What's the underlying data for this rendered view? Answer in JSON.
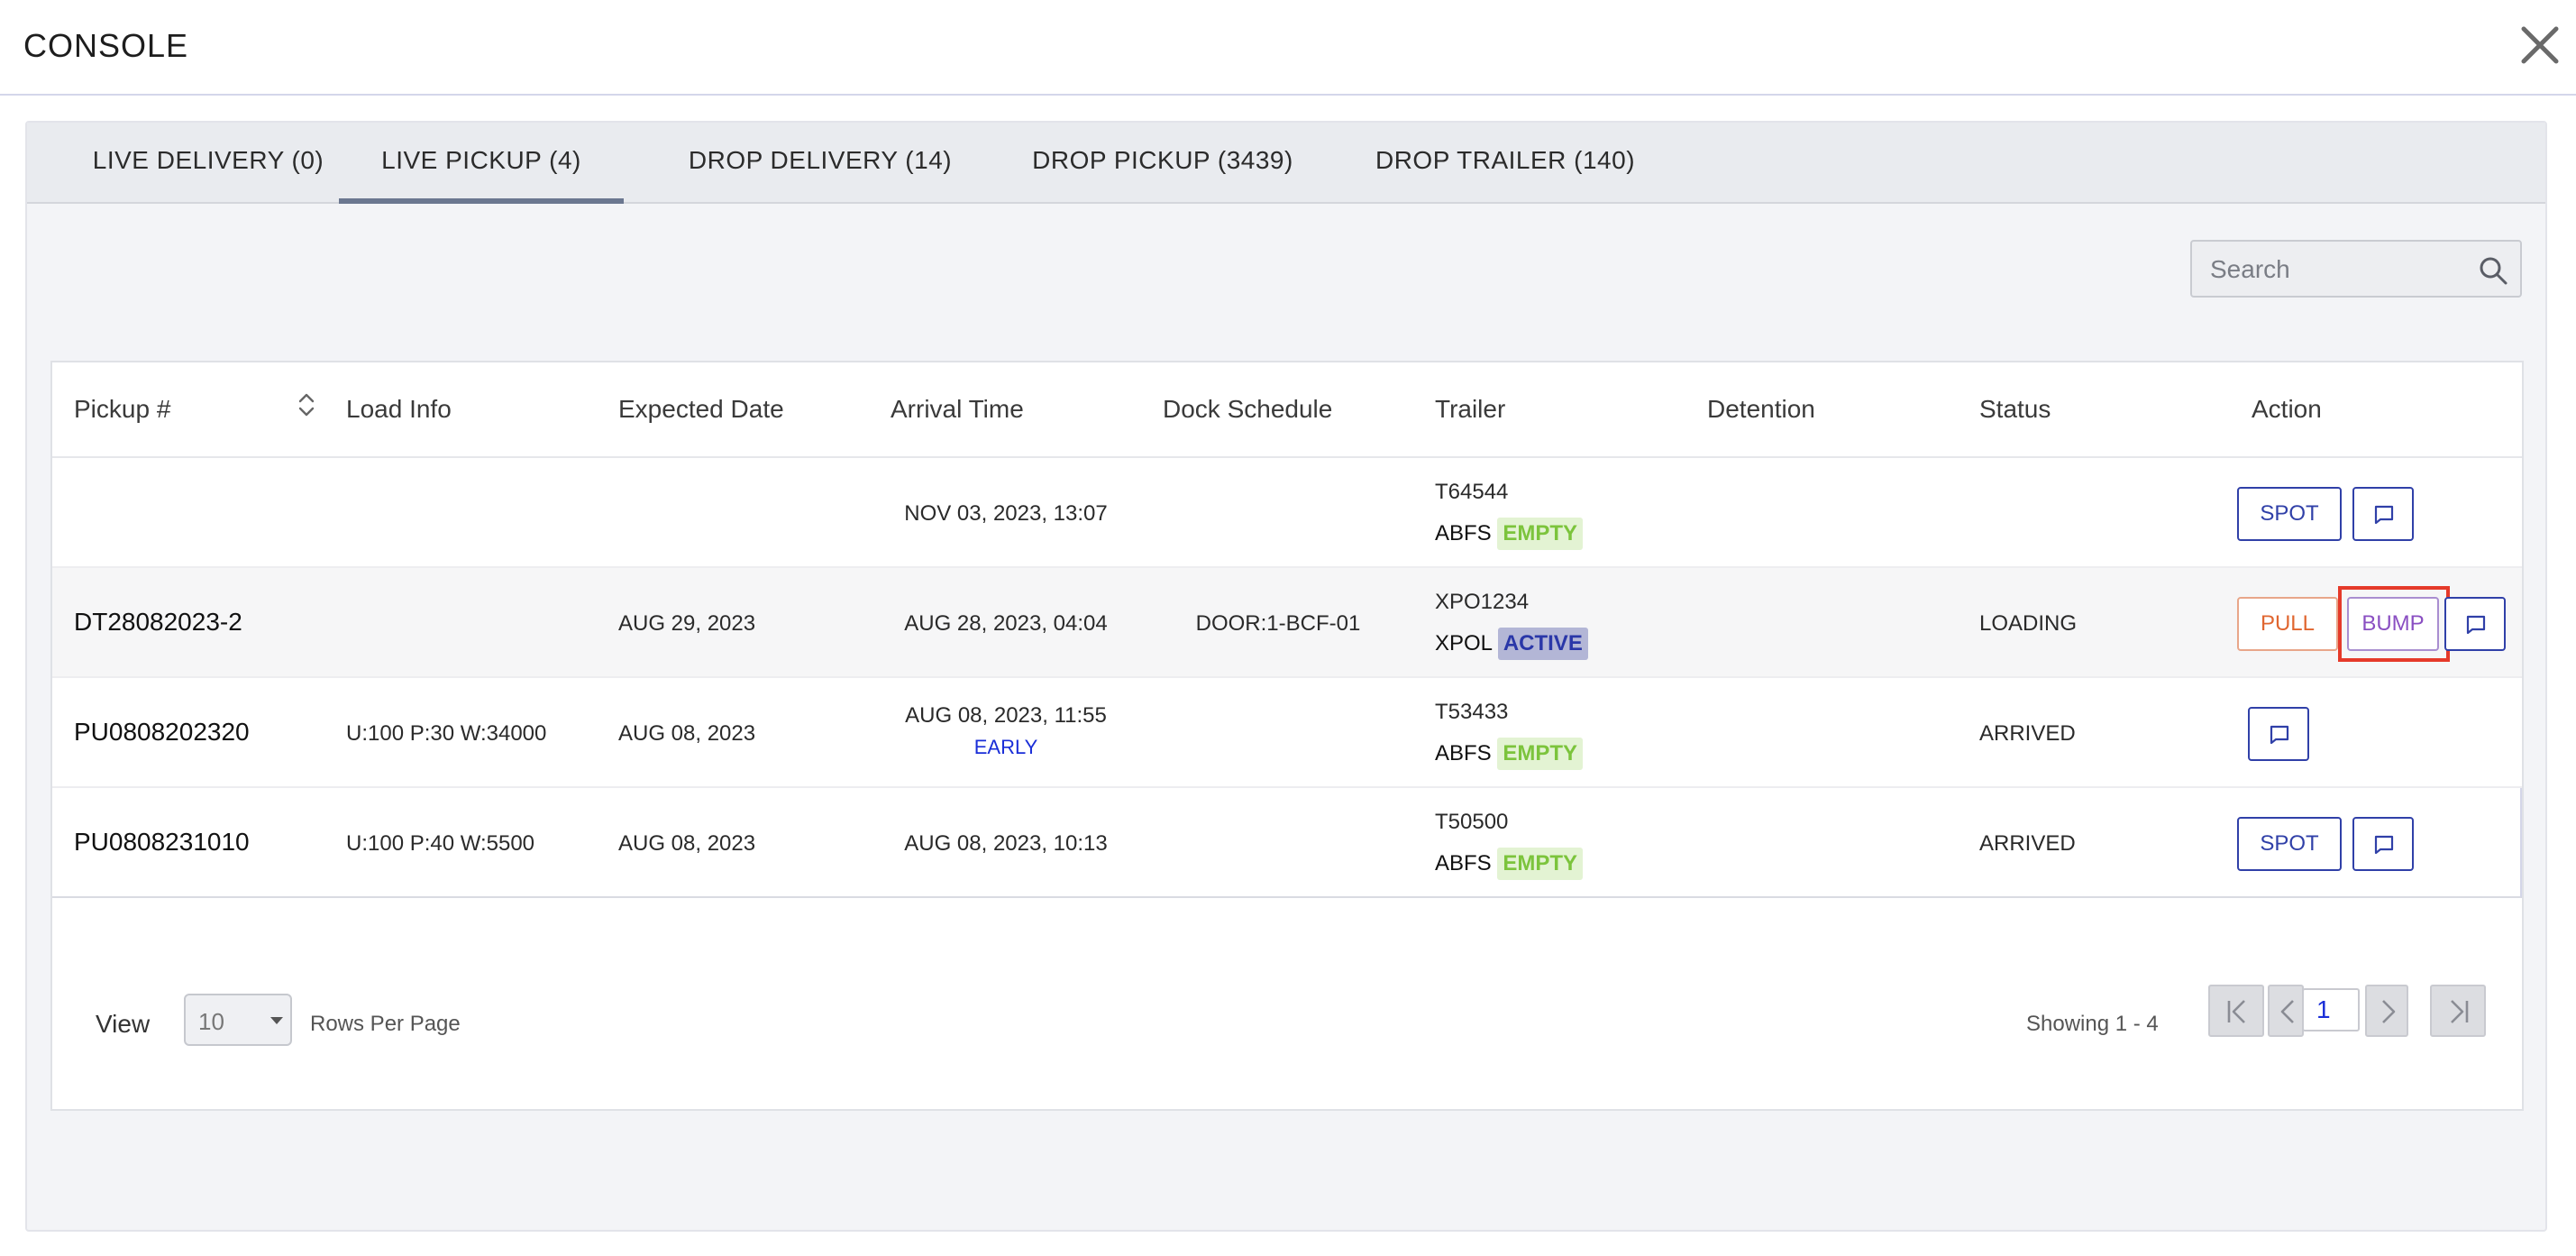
{
  "header": {
    "title": "CONSOLE",
    "close_icon": "close-icon"
  },
  "tabs": [
    {
      "label": "LIVE DELIVERY (0)",
      "active": false
    },
    {
      "label": "LIVE PICKUP (4)",
      "active": true
    },
    {
      "label": "DROP DELIVERY (14)",
      "active": false
    },
    {
      "label": "DROP PICKUP (3439)",
      "active": false
    },
    {
      "label": "DROP TRAILER (140)",
      "active": false
    }
  ],
  "search": {
    "placeholder": "Search",
    "value": ""
  },
  "table": {
    "columns": [
      "Pickup #",
      "Load Info",
      "Expected Date",
      "Arrival Time",
      "Dock Schedule",
      "Trailer",
      "Detention",
      "Status",
      "Action"
    ],
    "rows": [
      {
        "pickup": "",
        "load_info": "",
        "expected_date": "",
        "arrival_time": "NOV 03, 2023, 13:07",
        "arrival_note": "",
        "dock": "",
        "trailer_number": "T64544",
        "carrier": "ABFS",
        "trailer_state": "EMPTY",
        "detention": "",
        "status": "",
        "actions": [
          "SPOT"
        ]
      },
      {
        "pickup": "DT28082023-2",
        "load_info": "",
        "expected_date": "AUG 29, 2023",
        "arrival_time": "AUG 28, 2023, 04:04",
        "arrival_note": "",
        "dock": "DOOR:1-BCF-01",
        "trailer_number": "XPO1234",
        "carrier": "XPOL",
        "trailer_state": "ACTIVE",
        "detention": "",
        "status": "LOADING",
        "actions": [
          "PULL",
          "BUMP"
        ]
      },
      {
        "pickup": "PU0808202320",
        "load_info": "U:100 P:30 W:34000",
        "expected_date": "AUG 08, 2023",
        "arrival_time": "AUG 08, 2023, 11:55",
        "arrival_note": "EARLY",
        "dock": "",
        "trailer_number": "T53433",
        "carrier": "ABFS",
        "trailer_state": "EMPTY",
        "detention": "",
        "status": "ARRIVED",
        "actions": []
      },
      {
        "pickup": "PU0808231010",
        "load_info": "U:100 P:40 W:5500",
        "expected_date": "AUG 08, 2023",
        "arrival_time": "AUG 08, 2023, 10:13",
        "arrival_note": "",
        "dock": "",
        "trailer_number": "T50500",
        "carrier": "ABFS",
        "trailer_state": "EMPTY",
        "detention": "",
        "status": "ARRIVED",
        "actions": [
          "SPOT"
        ]
      }
    ]
  },
  "footer": {
    "view_label": "View",
    "rows_per_page": "10",
    "rows_per_page_label": "Rows Per Page",
    "showing": "Showing 1 - 4",
    "page": "1"
  },
  "colors": {
    "spot_border": "#3040a8",
    "pull_text": "#e06630",
    "bump_text": "#8a4fc2",
    "empty_tag_bg": "#e3f3d3",
    "active_tag_bg": "#b3b6d6",
    "highlight": "#e53a2a"
  }
}
